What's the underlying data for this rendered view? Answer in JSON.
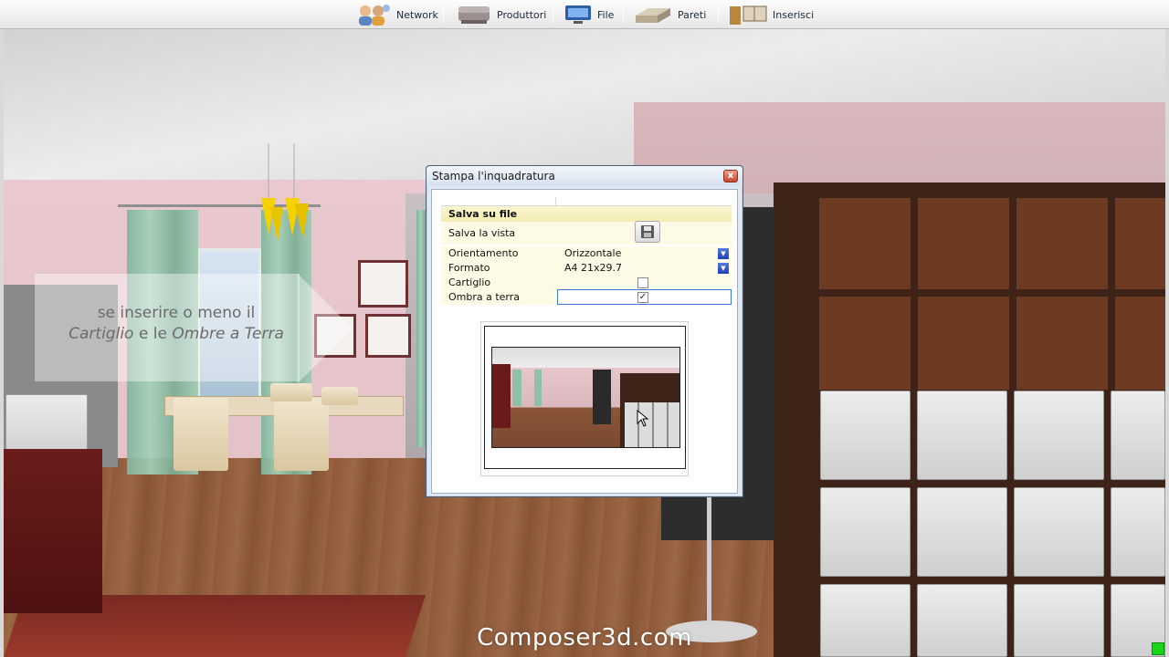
{
  "toolbar": {
    "items": [
      {
        "label": "Network",
        "icon": "network-users-icon"
      },
      {
        "label": "Produttori",
        "icon": "sofa-icon"
      },
      {
        "label": "File",
        "icon": "monitor-icon"
      },
      {
        "label": "Pareti",
        "icon": "wall-bricks-icon"
      },
      {
        "label": "Inserisci",
        "icon": "door-window-icon"
      }
    ]
  },
  "overlay": {
    "hint_line1": "se inserire o meno il",
    "hint_line2a": "Cartiglio",
    "hint_line2b": " e le ",
    "hint_line2c": "Ombre a Terra",
    "watermark": "Composer3d.com"
  },
  "dialog": {
    "title": "Stampa l'inquadratura",
    "close_glyph": "x",
    "section": "Salva su file",
    "rows": {
      "save_view": {
        "label": "Salva la vista"
      },
      "orientation": {
        "label": "Orientamento",
        "value": "Orizzontale"
      },
      "format": {
        "label": "Formato",
        "value": "A4 21x29.7"
      },
      "cartiglio": {
        "label": "Cartiglio",
        "checked": false
      },
      "shadow": {
        "label": "Ombra a terra",
        "checked": true,
        "check_glyph": "✓"
      }
    }
  },
  "colors": {
    "dialog_border": "#4c5f77",
    "section_bg": "#f3ecb2",
    "combo_button": "#1c3fb6",
    "status_led": "#19d619"
  }
}
